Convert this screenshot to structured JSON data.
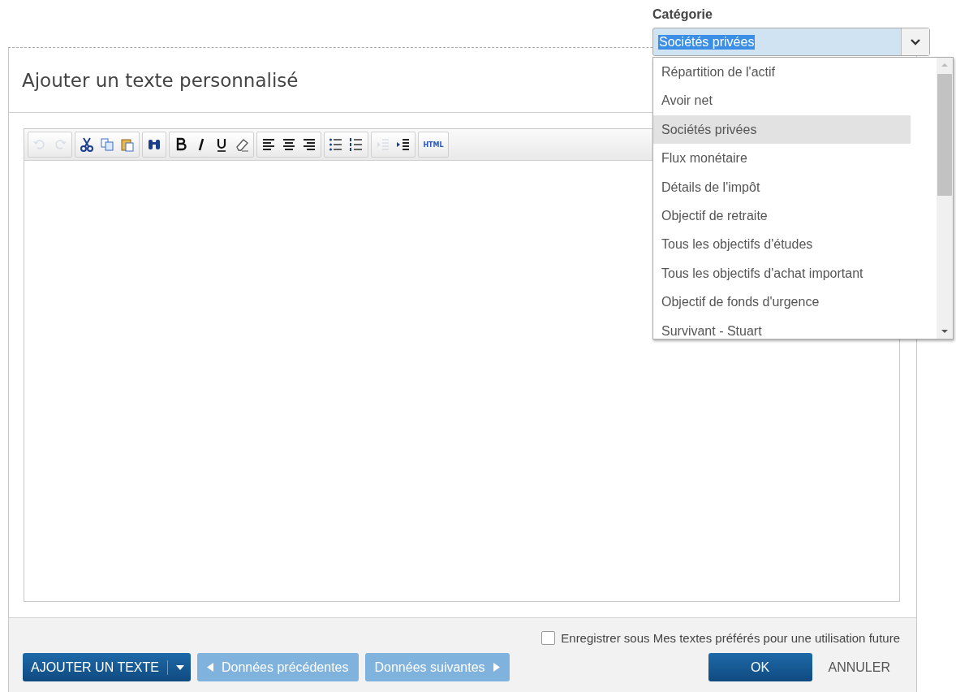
{
  "dialog": {
    "title": "Ajouter un texte personnalisé"
  },
  "toolbar": [
    [
      {
        "kind": "undo",
        "disabled": true
      },
      {
        "kind": "redo",
        "disabled": true
      }
    ],
    [
      {
        "kind": "cut",
        "disabled": false
      },
      {
        "kind": "copy",
        "disabled": false
      },
      {
        "kind": "paste",
        "disabled": false
      }
    ],
    [
      {
        "kind": "find",
        "disabled": false
      }
    ],
    [
      {
        "kind": "bold",
        "disabled": false
      },
      {
        "kind": "italic",
        "disabled": false
      },
      {
        "kind": "underline",
        "disabled": false
      },
      {
        "kind": "eraser",
        "disabled": false
      }
    ],
    [
      {
        "kind": "align-left",
        "disabled": false
      },
      {
        "kind": "align-center",
        "disabled": false
      },
      {
        "kind": "align-right",
        "disabled": false
      }
    ],
    [
      {
        "kind": "bullets",
        "disabled": false
      },
      {
        "kind": "numbers",
        "disabled": false
      }
    ],
    [
      {
        "kind": "outdent",
        "disabled": true
      },
      {
        "kind": "indent",
        "disabled": false
      }
    ],
    [
      {
        "kind": "html",
        "label": "HTML",
        "disabled": false
      }
    ]
  ],
  "save_favorite": {
    "label": "Enregistrer sous Mes textes préférés pour une utilisation future",
    "checked": false
  },
  "buttons": {
    "add_text": "AJOUTER UN TEXTE",
    "previous": "Données précédentes",
    "next": "Données suivantes",
    "ok": "OK",
    "cancel": "ANNULER"
  },
  "category": {
    "label": "Catégorie",
    "value": "Sociétés privées",
    "options": [
      {
        "label": "Répartition de l'actif",
        "selected": false
      },
      {
        "label": "Avoir net",
        "selected": false
      },
      {
        "label": "Sociétés privées",
        "selected": true
      },
      {
        "label": "Flux monétaire",
        "selected": false
      },
      {
        "label": "Détails de l'impôt",
        "selected": false
      },
      {
        "label": "Objectif de retraite",
        "selected": false
      },
      {
        "label": "Tous les objectifs d'études",
        "selected": false
      },
      {
        "label": "Tous les objectifs d'achat important",
        "selected": false
      },
      {
        "label": "Objectif de fonds d'urgence",
        "selected": false
      },
      {
        "label": "Survivant - Stuart",
        "selected": false
      }
    ]
  }
}
